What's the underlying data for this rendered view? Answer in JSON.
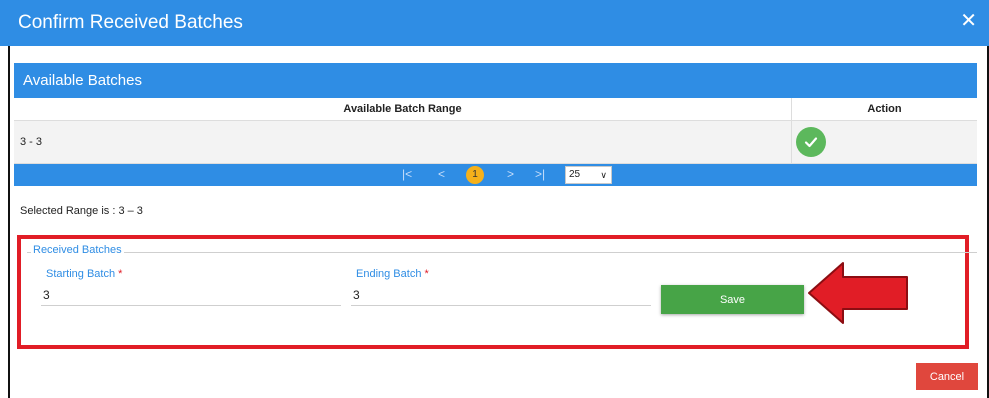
{
  "dialog": {
    "title": "Confirm Received Batches",
    "close_label": "✕"
  },
  "available": {
    "title": "Available Batches",
    "columns": [
      "Available Batch Range",
      "Action"
    ],
    "rows": [
      {
        "range": "3 - 3",
        "action_icon": "check-circle-icon"
      }
    ]
  },
  "pagination": {
    "first": "|<",
    "prev": "<",
    "current_page": "1",
    "next": ">",
    "last": ">|",
    "page_size": "25",
    "page_size_chevron": "∨"
  },
  "selected_range_text": "Selected Range is : 3 – 3",
  "received": {
    "legend": "Received Batches",
    "starting_label": "Starting Batch",
    "starting_value": "3",
    "ending_label": "Ending Batch",
    "ending_value": "3",
    "required_marker": "*",
    "save_label": "Save"
  },
  "cancel_label": "Cancel",
  "colors": {
    "header_blue": "#2f8de4",
    "save_green": "#47a447",
    "check_green": "#5cb85c",
    "highlight_red": "#e11d26",
    "cancel_red": "#e0473d",
    "page_badge": "#f5b11b"
  }
}
